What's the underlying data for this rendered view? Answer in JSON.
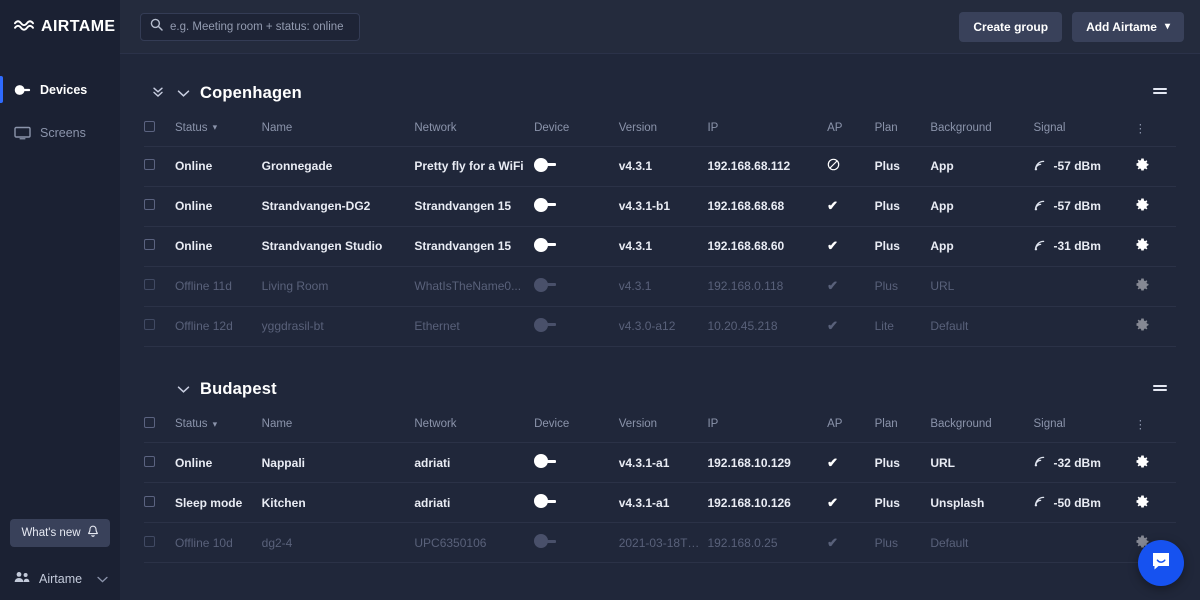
{
  "brand": {
    "name": "AIRTAME",
    "logo_icon": "airtame-wave-logo"
  },
  "sidebar": {
    "items": [
      {
        "label": "Devices",
        "icon": "dongle-icon",
        "active": true
      },
      {
        "label": "Screens",
        "icon": "monitor-icon",
        "active": false
      }
    ],
    "whats_new": {
      "label": "What's new",
      "icon": "bell-icon"
    },
    "account": {
      "label": "Airtame",
      "icon": "people-icon",
      "chevron": "chevron-down-icon"
    }
  },
  "topbar": {
    "search": {
      "placeholder": "e.g. Meeting room + status: online",
      "value": "",
      "icon": "search-icon"
    },
    "create_group_label": "Create group",
    "add_airtame_label": "Add Airtame",
    "add_airtame_caret": "▾"
  },
  "columns": {
    "status": "Status",
    "name": "Name",
    "network": "Network",
    "device": "Device",
    "version": "Version",
    "ip": "IP",
    "ap": "AP",
    "plan": "Plan",
    "background": "Background",
    "signal": "Signal",
    "sort_caret": "▾",
    "overflow": "⋮"
  },
  "groups": [
    {
      "title": "Copenhagen",
      "collapse_all_icon": "double-chevron-down-icon",
      "chevron_icon": "chevron-down-icon",
      "menu_icon": "list-menu-icon",
      "rows": [
        {
          "status": "Online",
          "name": "Gronnegade",
          "network": "Pretty fly for a WiFi",
          "device_icon": "dongle-online-icon",
          "version": "v4.3.1",
          "ip": "192.168.68.112",
          "ap": "blocked",
          "ap_glyph": "⊘",
          "plan": "Plus",
          "background": "App",
          "signal": "-57 dBm",
          "signal_icon": "wifi-signal-icon",
          "gear_icon": "gear-icon",
          "offline": false
        },
        {
          "status": "Online",
          "name": "Strandvangen-DG2",
          "network": "Strandvangen 15",
          "device_icon": "dongle-online-icon",
          "version": "v4.3.1-b1",
          "ip": "192.168.68.68",
          "ap": "check",
          "ap_glyph": "✔",
          "plan": "Plus",
          "background": "App",
          "signal": "-57 dBm",
          "signal_icon": "wifi-signal-icon",
          "gear_icon": "gear-icon",
          "offline": false
        },
        {
          "status": "Online",
          "name": "Strandvangen Studio",
          "network": "Strandvangen 15",
          "device_icon": "dongle-online-icon",
          "version": "v4.3.1",
          "ip": "192.168.68.60",
          "ap": "check",
          "ap_glyph": "✔",
          "plan": "Plus",
          "background": "App",
          "signal": "-31 dBm",
          "signal_icon": "wifi-signal-icon",
          "gear_icon": "gear-icon",
          "offline": false
        },
        {
          "status": "Offline 11d",
          "name": "Living Room",
          "network": "WhatIsTheName0...",
          "device_icon": "dongle-offline-icon",
          "version": "v4.3.1",
          "ip": "192.168.0.118",
          "ap": "check",
          "ap_glyph": "✔",
          "plan": "Plus",
          "background": "URL",
          "signal": "",
          "signal_icon": "",
          "gear_icon": "gear-icon",
          "offline": true
        },
        {
          "status": "Offline 12d",
          "name": "yggdrasil-bt",
          "network": "Ethernet",
          "device_icon": "dongle-offline-icon",
          "version": "v4.3.0-a12",
          "ip": "10.20.45.218",
          "ap": "check",
          "ap_glyph": "✔",
          "plan": "Lite",
          "background": "Default",
          "signal": "",
          "signal_icon": "",
          "gear_icon": "gear-icon",
          "offline": true
        }
      ]
    },
    {
      "title": "Budapest",
      "collapse_all_icon": "",
      "chevron_icon": "chevron-down-icon",
      "menu_icon": "list-menu-icon",
      "rows": [
        {
          "status": "Online",
          "name": "Nappali",
          "network": "adriati",
          "device_icon": "dongle-online-icon",
          "version": "v4.3.1-a1",
          "ip": "192.168.10.129",
          "ap": "check",
          "ap_glyph": "✔",
          "plan": "Plus",
          "background": "URL",
          "signal": "-32 dBm",
          "signal_icon": "wifi-signal-icon",
          "gear_icon": "gear-icon",
          "offline": false
        },
        {
          "status": "Sleep mode",
          "name": "Kitchen",
          "network": "adriati",
          "device_icon": "dongle-online-icon",
          "version": "v4.3.1-a1",
          "ip": "192.168.10.126",
          "ap": "check",
          "ap_glyph": "✔",
          "plan": "Plus",
          "background": "Unsplash",
          "signal": "-50 dBm",
          "signal_icon": "wifi-signal-icon",
          "gear_icon": "gear-icon",
          "offline": false
        },
        {
          "status": "Offline 10d",
          "name": "dg2-4",
          "network": "UPC6350106",
          "device_icon": "dongle-offline-icon",
          "version": "2021-03-18T0...",
          "ip": "192.168.0.25",
          "ap": "check",
          "ap_glyph": "✔",
          "plan": "Plus",
          "background": "Default",
          "signal": "",
          "signal_icon": "",
          "gear_icon": "gear-icon",
          "offline": true
        }
      ]
    }
  ],
  "intercom": {
    "icon": "chat-bubble-icon"
  },
  "colors": {
    "sidebar_bg": "#1b2133",
    "topbar_bg": "#242b3d",
    "content_bg": "#20273a",
    "accent_blue": "#2f6bff",
    "intercom_blue": "#1652f0",
    "text_primary": "#e9ecf4",
    "text_muted": "#8b94ab",
    "text_offline": "#59617a",
    "divider": "#2b3247"
  }
}
